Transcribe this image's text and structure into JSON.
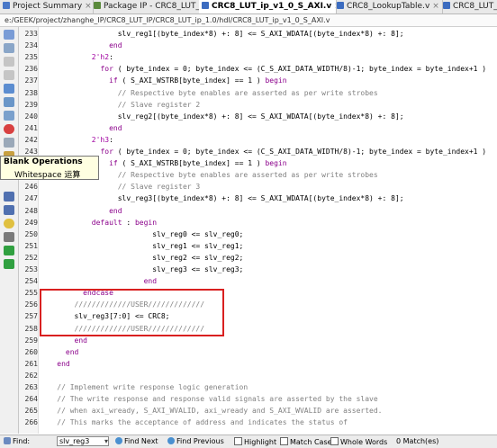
{
  "tabs": [
    {
      "label": "Project Summary",
      "color": "#4a78c8"
    },
    {
      "label": "Package IP - CRC8_LUT_ip",
      "color": "#5a8a3c"
    },
    {
      "label": "CRC8_LUT_ip_v1_0_S_AXI.v",
      "color": "#3c6cc0"
    },
    {
      "label": "CRC8_LookupTable.v",
      "color": "#3c6cc0"
    },
    {
      "label": "CRC8_LUT_i",
      "color": "#3c6cc0"
    }
  ],
  "tab_close": "×",
  "path": "e:/GEEK/project/zhanghe_IP/CRC8_LUT_IP/CRC8_LUT_ip_1.0/hdl/CRC8_LUT_ip_v1_0_S_AXI.v",
  "tooltip": {
    "title": "Blank Operations",
    "desc": "Whitespace 运算"
  },
  "lines": [
    {
      "n": "233",
      "t": "                  slv_reg1[(byte_index*8) +: 8] <= S_AXI_WDATA[(byte_index*8) +: 8];"
    },
    {
      "n": "234",
      "t": "                end"
    },
    {
      "n": "235",
      "t": "            2'h2:"
    },
    {
      "n": "236",
      "t": "              for ( byte_index = 0; byte_index <= (C_S_AXI_DATA_WIDTH/8)-1; byte_index = byte_index+1 )"
    },
    {
      "n": "237",
      "t": "                if ( S_AXI_WSTRB[byte_index] == 1 ) begin"
    },
    {
      "n": "238",
      "t": "                  // Respective byte enables are asserted as per write strobes"
    },
    {
      "n": "239",
      "t": "                  // Slave register 2"
    },
    {
      "n": "240",
      "t": "                  slv_reg2[(byte_index*8) +: 8] <= S_AXI_WDATA[(byte_index*8) +: 8];"
    },
    {
      "n": "241",
      "t": "                end"
    },
    {
      "n": "242",
      "t": "            2'h3:"
    },
    {
      "n": "243",
      "t": "              for ( byte_index = 0; byte_index <= (C_S_AXI_DATA_WIDTH/8)-1; byte_index = byte_index+1 )"
    },
    {
      "n": "244",
      "t": "                if ( S_AXI_WSTRB[byte_index] == 1 ) begin"
    },
    {
      "n": "245",
      "t": "                  // Respective byte enables are asserted as per write strobes"
    },
    {
      "n": "246",
      "t": "                  // Slave register 3"
    },
    {
      "n": "247",
      "t": "                  slv_reg3[(byte_index*8) +: 8] <= S_AXI_WDATA[(byte_index*8) +: 8];"
    },
    {
      "n": "248",
      "t": "                end"
    },
    {
      "n": "249",
      "t": "            default : begin"
    },
    {
      "n": "250",
      "t": "                          slv_reg0 <= slv_reg0;"
    },
    {
      "n": "251",
      "t": "                          slv_reg1 <= slv_reg1;"
    },
    {
      "n": "252",
      "t": "                          slv_reg2 <= slv_reg2;"
    },
    {
      "n": "253",
      "t": "                          slv_reg3 <= slv_reg3;"
    },
    {
      "n": "254",
      "t": "                        end"
    },
    {
      "n": "255",
      "t": "          endcase"
    },
    {
      "n": "256",
      "t": "        /////////////USER/////////////"
    },
    {
      "n": "257",
      "t": "        slv_reg3[7:0] <= CRC8;"
    },
    {
      "n": "258",
      "t": "        /////////////USER/////////////"
    },
    {
      "n": "259",
      "t": "        end"
    },
    {
      "n": "260",
      "t": "      end"
    },
    {
      "n": "261",
      "t": "    end"
    },
    {
      "n": "262",
      "t": ""
    },
    {
      "n": "263",
      "t": "    // Implement write response logic generation"
    },
    {
      "n": "264",
      "t": "    // The write response and response valid signals are asserted by the slave"
    },
    {
      "n": "265",
      "t": "    // when axi_wready, S_AXI_WVALID, axi_wready and S_AXI_WVALID are asserted."
    },
    {
      "n": "266",
      "t": "    // This marks the acceptance of address and indicates the status of"
    }
  ],
  "find": {
    "label": "Find:",
    "value": "slv_reg3",
    "next": "Find Next",
    "prev": "Find Previous",
    "highlight": "Highlight",
    "match_case": "Match Case",
    "whole_words": "Whole Words",
    "matches": "0 Match(es)"
  }
}
